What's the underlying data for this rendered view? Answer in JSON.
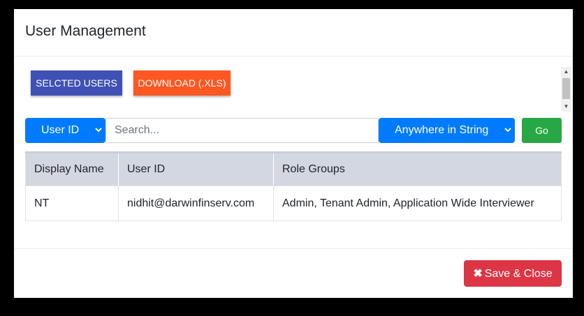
{
  "modal": {
    "title": "User Management"
  },
  "toolbar": {
    "selected_users_label": "SELCTED USERS",
    "download_label": "DOWNLOAD (.XLS)"
  },
  "filter": {
    "field_select": {
      "selected": "User ID"
    },
    "search": {
      "value": "",
      "placeholder": "Search..."
    },
    "match_select": {
      "selected": "Anywhere in String"
    },
    "go_label": "Go"
  },
  "table": {
    "columns": [
      "Display Name",
      "User ID",
      "Role Groups"
    ],
    "rows": [
      [
        "NT",
        "nidhit@darwinfinserv.com",
        "Admin, Tenant Admin, Application Wide Interviewer"
      ]
    ]
  },
  "footer": {
    "save_close_icon": "✖",
    "save_close_label": "Save & Close"
  },
  "colors": {
    "indigo": "#3f51b5",
    "deep_orange": "#ff5722",
    "primary": "#007bff",
    "success": "#28a745",
    "danger": "#dc3545"
  },
  "icons": {
    "scroll_up": "▲",
    "scroll_down": "▼",
    "chevron": "⌄"
  }
}
